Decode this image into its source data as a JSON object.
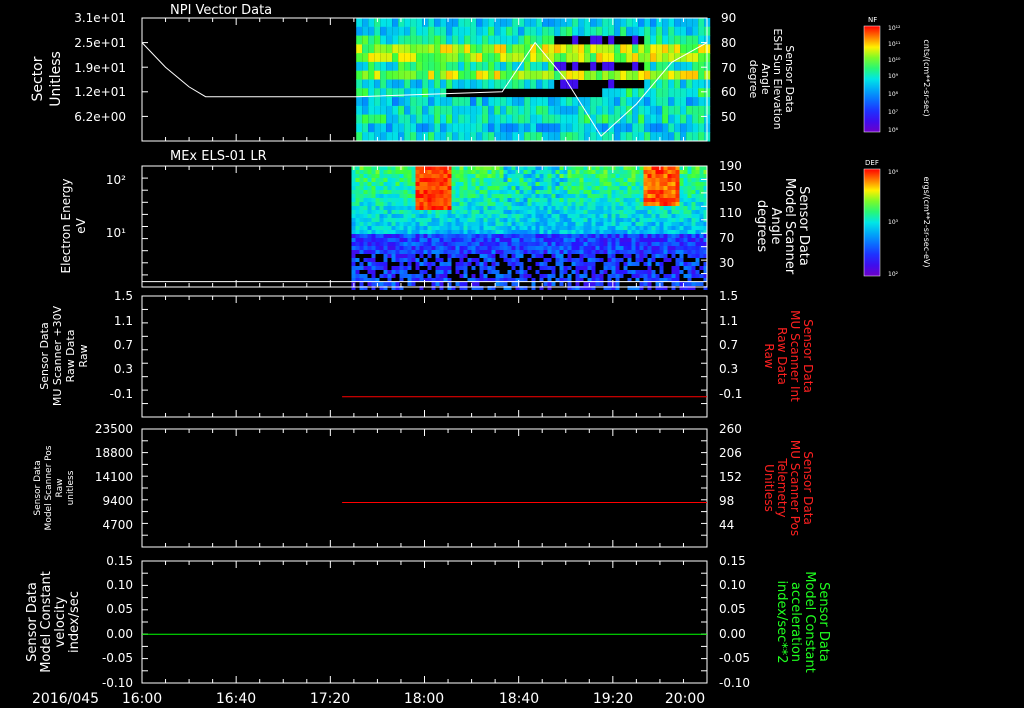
{
  "date_label": "2016/045",
  "time_ticks": [
    "16:00",
    "16:40",
    "17:20",
    "18:00",
    "18:40",
    "19:20",
    "20:00"
  ],
  "panels": [
    {
      "id": "npi",
      "title": "NPI Vector Data",
      "left_label": [
        "Sector",
        "Unitless"
      ],
      "left_ticks": [
        "3.1e+01",
        "2.5e+01",
        "1.9e+01",
        "1.2e+01",
        "6.2e+00"
      ],
      "right_label": [
        "Sensor Data",
        "ESH Sun Elevation",
        "Angle",
        "degree"
      ],
      "right_ticks": [
        "90",
        "80",
        "70",
        "60",
        "50"
      ],
      "colorbar": {
        "title": "NF",
        "label": "cnts/(cm**2-sr-sec)",
        "ticks": [
          "10¹²",
          "10¹¹",
          "10¹⁰",
          "10⁹",
          "10⁸",
          "10⁷",
          "10⁶"
        ]
      }
    },
    {
      "id": "els",
      "title": "MEx ELS-01 LR",
      "left_label": [
        "Electron Energy",
        "eV"
      ],
      "left_ticks": [
        "10²",
        "10¹"
      ],
      "right_label": [
        "Sensor Data",
        "Model Scanner",
        "Angle",
        "degrees"
      ],
      "right_ticks": [
        "190",
        "150",
        "110",
        "70",
        "30"
      ],
      "colorbar": {
        "title": "DEF",
        "label": "ergs/(cm**2-sr-sec-eV)",
        "ticks": [
          "10⁴",
          "10³",
          "10²"
        ]
      }
    },
    {
      "id": "mu",
      "left_label": [
        "Sensor Data",
        "MU Scanner +30V",
        "Raw Data",
        "Raw"
      ],
      "left_ticks": [
        "1.5",
        "1.1",
        "0.7",
        "0.3",
        "-0.1"
      ],
      "right_label": [
        "Sensor Data",
        "MU Scanner Int",
        "Raw Data",
        "Raw"
      ],
      "right_ticks": [
        "1.5",
        "1.1",
        "0.7",
        "0.3",
        "-0.1"
      ]
    },
    {
      "id": "pos",
      "left_label": [
        "Sensor Data",
        "Model Scanner Pos",
        "Raw",
        "unitless"
      ],
      "left_ticks": [
        "23500",
        "18800",
        "14100",
        "9400",
        "4700"
      ],
      "right_label": [
        "Sensor Data",
        "MU Scanner Pos",
        "Telemetry",
        "Unitless"
      ],
      "right_ticks": [
        "260",
        "206",
        "152",
        "98",
        "44"
      ]
    },
    {
      "id": "vel",
      "left_label": [
        "Sensor Data",
        "Model Constant",
        "velocity",
        "index/sec"
      ],
      "left_ticks": [
        "0.15",
        "0.10",
        "0.05",
        "0.00",
        "-0.05",
        "-0.10"
      ],
      "right_label": [
        "Sensor Data",
        "Model Constant",
        "acceleration",
        "index/sec**2"
      ],
      "right_ticks": [
        "0.15",
        "0.10",
        "0.05",
        "0.00",
        "-0.05",
        "-0.10"
      ]
    }
  ],
  "colors": {
    "axis": "#ffffff",
    "red_trace": "#ff0000",
    "green_trace": "#00ff00",
    "red_label": "#ff2020",
    "green_label": "#20ff20"
  },
  "chart_data": [
    {
      "type": "heatmap",
      "panel": "NPI Vector Data",
      "x_range": [
        "16:00",
        "20:00"
      ],
      "y_axis": "Sector (Unitless)",
      "data_start": "17:31",
      "overlay_line": {
        "name": "ESH Sun Elevation Angle",
        "unit": "degree",
        "ylim": [
          40,
          90
        ],
        "x": [
          "16:00",
          "16:10",
          "16:20",
          "16:27",
          "17:31",
          "18:33",
          "18:40",
          "18:47",
          "19:00",
          "19:15",
          "19:30",
          "19:45",
          "20:00"
        ],
        "y": [
          80,
          70,
          62,
          58,
          58,
          60,
          70,
          80,
          65,
          42,
          55,
          72,
          80
        ]
      }
    },
    {
      "type": "heatmap",
      "panel": "MEx ELS-01 LR",
      "x_range": [
        "16:00",
        "20:00"
      ],
      "y_axis": "Electron Energy (eV), log scale",
      "data_start": "17:29",
      "overlay_line": {
        "name": "Model Scanner Angle",
        "unit": "degrees",
        "ylim": [
          10,
          190
        ],
        "x": [
          "16:00",
          "20:00"
        ],
        "y": [
          18,
          18
        ]
      }
    },
    {
      "type": "line",
      "panel": "MU Scanner +30V / MU Scanner Int",
      "ylim": [
        -0.3,
        1.5
      ],
      "series": [
        {
          "name": "MU Scanner Int",
          "x": [
            "17:25",
            "20:00"
          ],
          "y": [
            0.0,
            0.0
          ]
        }
      ]
    },
    {
      "type": "line",
      "panel": "Model Scanner Pos / MU Scanner Pos",
      "ylim": [
        0,
        260
      ],
      "series": [
        {
          "name": "MU Scanner Pos",
          "x": [
            "17:25",
            "20:00"
          ],
          "y": [
            98,
            98
          ]
        }
      ]
    },
    {
      "type": "line",
      "panel": "Model Constant velocity / acceleration",
      "ylim": [
        -0.1,
        0.15
      ],
      "series": [
        {
          "name": "Model Constant acceleration",
          "x": [
            "16:00",
            "20:00"
          ],
          "y": [
            0.0,
            0.0
          ]
        }
      ]
    }
  ]
}
